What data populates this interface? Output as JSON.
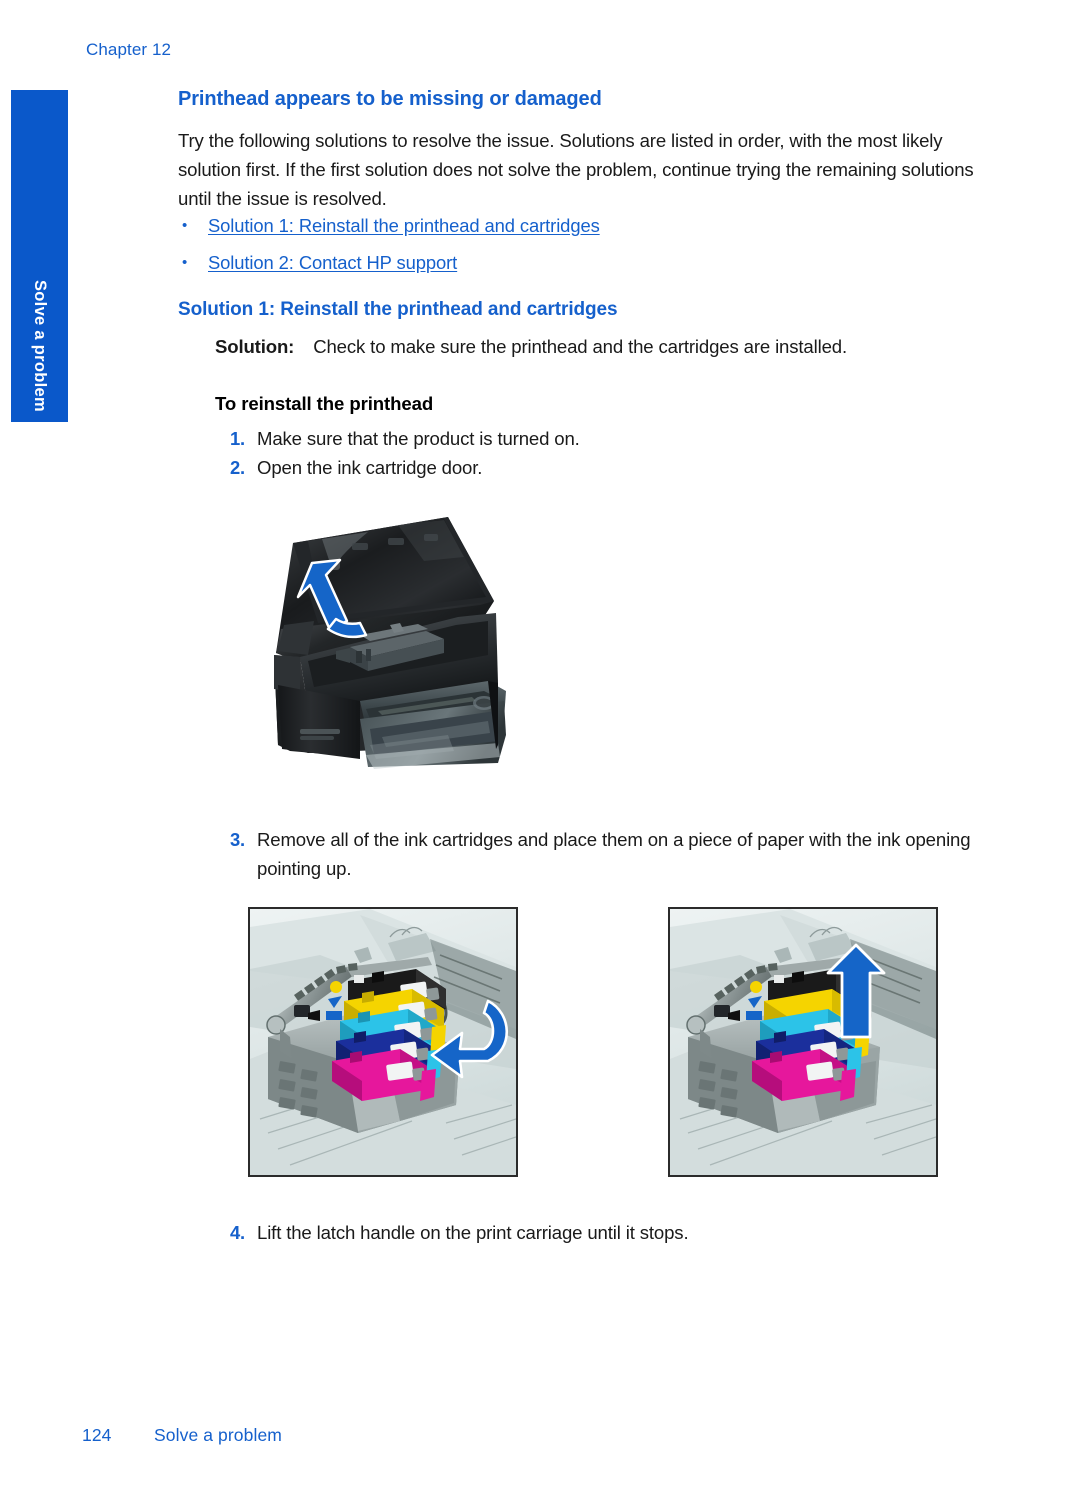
{
  "page": {
    "chapter_label": "Chapter 12",
    "side_tab_label": "Solve a problem",
    "page_number": "124",
    "footer_section": "Solve a problem",
    "accent_blue": "#1560cc",
    "tab_blue": "#0a58ca",
    "arrow_blue": "#1565c8"
  },
  "topic": {
    "title": "Printhead appears to be missing or damaged",
    "intro": "Try the following solutions to resolve the issue. Solutions are listed in order, with the most likely solution first. If the first solution does not solve the problem, continue trying the remaining solutions until the issue is resolved.",
    "links": [
      {
        "bullet": "•",
        "text": "Solution 1: Reinstall the printhead and cartridges"
      },
      {
        "bullet": "•",
        "text": "Solution 2: Contact HP support"
      }
    ]
  },
  "solution": {
    "heading": "Solution 1: Reinstall the printhead and cartridges",
    "label": "Solution:",
    "body": "Check to make sure the printhead and the cartridges are installed.",
    "procedure_title": "To reinstall the printhead",
    "steps": [
      {
        "num": "1.",
        "text": "Make sure that the product is turned on."
      },
      {
        "num": "2.",
        "text": "Open the ink cartridge door."
      },
      {
        "num": "3.",
        "text": "Remove all of the ink cartridges and place them on a piece of paper with the ink opening pointing up."
      },
      {
        "num": "4.",
        "text": "Lift the latch handle on the print carriage until it stops."
      }
    ]
  },
  "figures": {
    "printer": {
      "name": "printer-with-open-lid-illustration",
      "arrow": "curved-up-arrow"
    },
    "carriage_left": {
      "name": "print-carriage-cartridges-illustration",
      "arrow": "curved-left-arrow",
      "cartridge_colors": [
        "#111111",
        "#f5d400",
        "#2cc3e8",
        "#1b2f9c",
        "#e6179c"
      ]
    },
    "carriage_right": {
      "name": "print-carriage-remove-cartridge-illustration",
      "arrow": "up-arrow",
      "cartridge_colors": [
        "#111111",
        "#f5d400",
        "#2cc3e8",
        "#1b2f9c",
        "#e6179c"
      ]
    }
  }
}
